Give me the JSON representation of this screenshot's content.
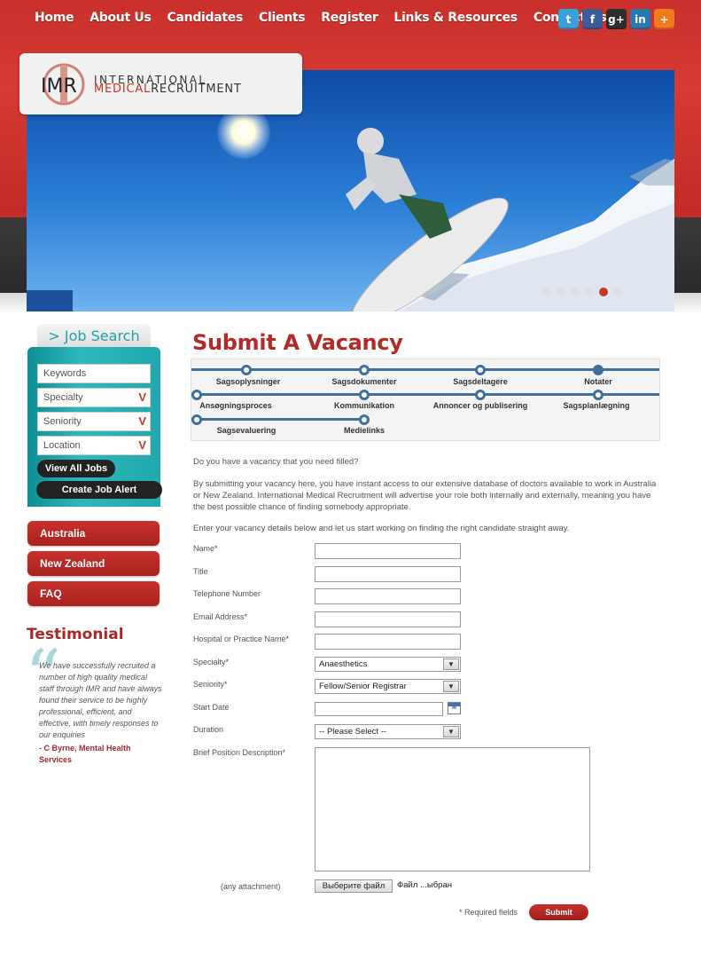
{
  "nav": {
    "items": [
      "Home",
      "About Us",
      "Candidates",
      "Clients",
      "Register",
      "Links & Resources",
      "Contact Us"
    ]
  },
  "social": {
    "icons": [
      "twitter-icon",
      "facebook-icon",
      "google-plus-icon",
      "linkedin-icon",
      "share-plus-icon"
    ],
    "glyphs": [
      "t",
      "f",
      "g+",
      "in",
      "+"
    ]
  },
  "logo": {
    "mark": "IMR",
    "line1": "INTERNATIONAL",
    "line2_accent": "MEDICAL",
    "line2_rest": "RECRUITMENT"
  },
  "banner": {
    "slide_count": 6,
    "active_slide": 5
  },
  "job_search": {
    "tab": "> Job Search",
    "keywords_placeholder": "Keywords",
    "specialty": "Specialty",
    "seniority": "Seniority",
    "location": "Location",
    "view_all": "View All Jobs",
    "create_alert": "Create Job Alert"
  },
  "sidebar": {
    "links": [
      "Australia",
      "New Zealand",
      "FAQ"
    ]
  },
  "testimonial": {
    "heading": "Testimonial",
    "quote_mark": "“",
    "text": "We have successfully recruited a number of high quality medical staff through IMR and have always found their service to be highly professional, efficient, and effective, with timely responses to our enquiries",
    "author": "- C Byrne, Mental Health Services"
  },
  "main": {
    "title": "Submit A Vacancy",
    "steps": {
      "row1": [
        "Sagsoplysninger",
        "Sagsdokumenter",
        "Sagsdeltagere",
        "Notater"
      ],
      "row2": [
        "Ansøgningsproces",
        "Kommunikation",
        "Annoncer og publisering",
        "Sagsplanlægning"
      ],
      "row3": [
        "Sagsevaluering",
        "Medielinks"
      ]
    },
    "intro1": "Do you have a vacancy that you need filled?",
    "intro2": "By submitting your vacancy here, you have instant access to our extensive database of doctors available to work in Australia or New Zealand. International Medical Recruitment will advertise your role both internally and externally, meaning you have the best possible chance of finding somebody appropriate.",
    "intro3": "Enter your vacancy details below and let us start working on finding the right candidate straight away."
  },
  "form": {
    "name": "Name*",
    "title": "Title",
    "telephone": "Telephone Number",
    "email": "Email Address*",
    "hospital": "Hospital or Practice Name*",
    "specialty": "Specialty*",
    "specialty_value": "Anaesthetics",
    "seniority": "Seniority*",
    "seniority_value": "Fellow/Senior Registrar",
    "start_date": "Start Date",
    "duration": "Duration",
    "duration_value": "-- Please Select --",
    "description": "Brief Position Description*",
    "attachment": "(any attachment)",
    "file_button": "Выберите файл",
    "file_status": "Файл ...ыбран",
    "required_note": "* Required fields",
    "submit": "Submit"
  }
}
